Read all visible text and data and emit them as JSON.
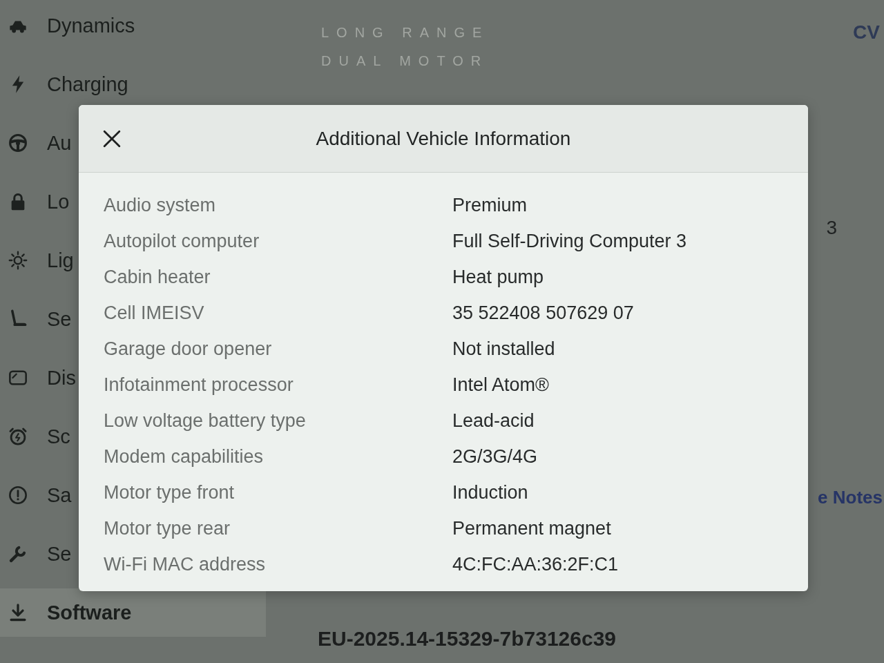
{
  "sidebar": {
    "items": [
      {
        "label": "Dynamics",
        "selected": false
      },
      {
        "label": "Charging",
        "selected": false
      },
      {
        "label": "Au",
        "selected": false
      },
      {
        "label": "Lo",
        "selected": false
      },
      {
        "label": "Lig",
        "selected": false
      },
      {
        "label": "Se",
        "selected": false
      },
      {
        "label": "Dis",
        "selected": false
      },
      {
        "label": "Sc",
        "selected": false
      },
      {
        "label": "Sa",
        "selected": false
      },
      {
        "label": "Se",
        "selected": false
      },
      {
        "label": "Software",
        "selected": true
      }
    ]
  },
  "main": {
    "trim_lines": [
      "LONG RANGE",
      "DUAL MOTOR"
    ],
    "corner_text": "CV",
    "value_fragment": "3",
    "release_notes_link": "e Notes",
    "software_version": "EU-2025.14-15329-7b73126c39"
  },
  "dialog": {
    "title": "Additional Vehicle Information",
    "rows": [
      {
        "label": "Audio system",
        "value": "Premium"
      },
      {
        "label": "Autopilot computer",
        "value": "Full Self-Driving Computer 3"
      },
      {
        "label": "Cabin heater",
        "value": "Heat pump"
      },
      {
        "label": "Cell IMEISV",
        "value": "35 522408 507629 07"
      },
      {
        "label": "Garage door opener",
        "value": "Not installed"
      },
      {
        "label": "Infotainment processor",
        "value": "Intel Atom®"
      },
      {
        "label": "Low voltage battery type",
        "value": "Lead-acid"
      },
      {
        "label": "Modem capabilities",
        "value": "2G/3G/4G"
      },
      {
        "label": "Motor type front",
        "value": "Induction"
      },
      {
        "label": "Motor type rear",
        "value": "Permanent magnet"
      },
      {
        "label": "Wi-Fi MAC address",
        "value": "4C:FC:AA:36:2F:C1"
      }
    ]
  }
}
